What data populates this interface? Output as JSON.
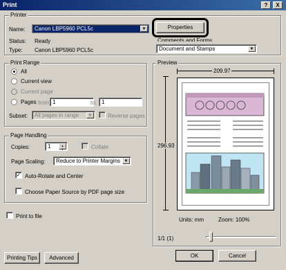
{
  "window": {
    "title": "Print",
    "help": "?",
    "close": "X"
  },
  "printer": {
    "legend": "Printer",
    "name_label": "Name:",
    "name_value": "Canon LBP5960 PCL5c",
    "properties_label": "Properties",
    "status_label": "Status:",
    "status_value": "Ready",
    "type_label": "Type:",
    "type_value": "Canon LBP5960 PCL5c",
    "comments_label": "Comments and Forms",
    "comments_value": "Document and Stamps"
  },
  "print_range": {
    "legend": "Print Range",
    "all": "All",
    "current_view": "Current view",
    "current_page": "Current page",
    "pages": "Pages",
    "from_label": "from:",
    "from_value": "1",
    "to_label": "to:",
    "to_value": "1",
    "subset_label": "Subset:",
    "subset_value": "All pages in range",
    "reverse_pages": "Reverse pages"
  },
  "page_handling": {
    "legend": "Page Handling",
    "copies_label": "Copies:",
    "copies_value": "1",
    "collate": "Collate",
    "scaling_label": "Page Scaling:",
    "scaling_value": "Reduce to Printer Margins",
    "auto_rotate": "Auto-Rotate and Center",
    "choose_paper": "Choose Paper Source by PDF page size"
  },
  "print_to_file": "Print to file",
  "preview": {
    "legend": "Preview",
    "width": "209.97",
    "height": "296.93",
    "units": "Units: mm",
    "zoom": "Zoom: 100%",
    "page_indicator": "1/1 (1)",
    "slider_position": 0.05
  },
  "buttons": {
    "printing_tips": "Printing Tips",
    "advanced": "Advanced",
    "ok": "OK",
    "cancel": "Cancel"
  }
}
